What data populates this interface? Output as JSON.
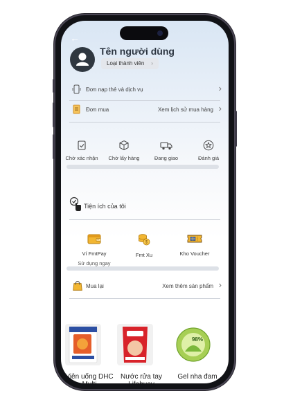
{
  "header": {
    "username": "Tên người dùng",
    "member_label": "Loại thành viên"
  },
  "rows": {
    "topup": {
      "label": "Đơn nạp thẻ và dịch vụ"
    },
    "orders": {
      "label": "Đơn mua",
      "link": "Xem lịch sử mua hàng"
    }
  },
  "order_status": [
    {
      "label": "Chờ xác nhận",
      "icon": "pending-confirm-icon"
    },
    {
      "label": "Chờ lấy hàng",
      "icon": "box-icon"
    },
    {
      "label": "Đang giao",
      "icon": "delivery-truck-icon"
    },
    {
      "label": "Đánh giá",
      "icon": "star-icon"
    }
  ],
  "utilities": {
    "title": "Tiện ích của tôi",
    "items": [
      {
        "label": "Ví FmtPay",
        "sub": "Sử dụng ngay",
        "icon": "wallet-icon"
      },
      {
        "label": "Fmt Xu",
        "icon": "coins-icon"
      },
      {
        "label": "Kho Voucher",
        "icon": "voucher-icon"
      }
    ]
  },
  "rebuy": {
    "label": "Mua lại",
    "link": "Xem thêm sản phẩm",
    "products": [
      {
        "name": "Viên uống DHC Multi"
      },
      {
        "name": "Nước rửa tay Lifebuoy"
      },
      {
        "name": "Gel nha đam",
        "badge_text": "98%"
      }
    ]
  },
  "colors": {
    "accent_orange": "#e79a2a",
    "avatar_dark": "#2f3740",
    "phone_frame": "#111216"
  }
}
